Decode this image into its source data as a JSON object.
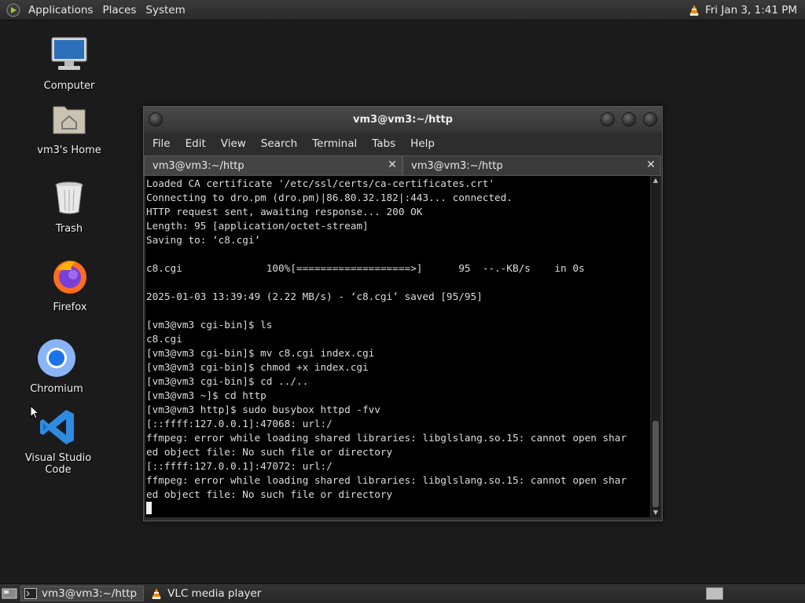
{
  "top_panel": {
    "menus": [
      "Applications",
      "Places",
      "System"
    ],
    "clock": "Fri Jan  3,  1:41 PM"
  },
  "desktop_icons": [
    {
      "label": "Computer",
      "icon": "computer-icon"
    },
    {
      "label": "vm3's Home",
      "icon": "home-folder-icon"
    },
    {
      "label": "Trash",
      "icon": "trash-icon"
    },
    {
      "label": "Firefox",
      "icon": "firefox-icon"
    },
    {
      "label": "Chromium",
      "icon": "chromium-icon"
    },
    {
      "label": "Visual Studio Code",
      "icon": "vscode-icon"
    }
  ],
  "terminal": {
    "title": "vm3@vm3:~/http",
    "menu": [
      "File",
      "Edit",
      "View",
      "Search",
      "Terminal",
      "Tabs",
      "Help"
    ],
    "tabs": [
      {
        "label": "vm3@vm3:~/http",
        "active": true
      },
      {
        "label": "vm3@vm3:~/http",
        "active": false
      }
    ],
    "lines": [
      "Loaded CA certificate '/etc/ssl/certs/ca-certificates.crt'",
      "Connecting to dro.pm (dro.pm)|86.80.32.182|:443... connected.",
      "HTTP request sent, awaiting response... 200 OK",
      "Length: 95 [application/octet-stream]",
      "Saving to: ‘c8.cgi’",
      "",
      "c8.cgi              100%[===================>]      95  --.-KB/s    in 0s",
      "",
      "2025-01-03 13:39:49 (2.22 MB/s) - ‘c8.cgi’ saved [95/95]",
      "",
      "[vm3@vm3 cgi-bin]$ ls",
      "c8.cgi",
      "[vm3@vm3 cgi-bin]$ mv c8.cgi index.cgi",
      "[vm3@vm3 cgi-bin]$ chmod +x index.cgi",
      "[vm3@vm3 cgi-bin]$ cd ../..",
      "[vm3@vm3 ~]$ cd http",
      "[vm3@vm3 http]$ sudo busybox httpd -fvv",
      "[::ffff:127.0.0.1]:47068: url:/",
      "ffmpeg: error while loading shared libraries: libglslang.so.15: cannot open shar",
      "ed object file: No such file or directory",
      "[::ffff:127.0.0.1]:47072: url:/",
      "ffmpeg: error while loading shared libraries: libglslang.so.15: cannot open shar",
      "ed object file: No such file or directory"
    ]
  },
  "taskbar": {
    "items": [
      {
        "label": "vm3@vm3:~/http",
        "icon": "terminal-icon",
        "active": true
      },
      {
        "label": "VLC media player",
        "icon": "vlc-icon",
        "active": false
      }
    ]
  },
  "colors": {
    "desktop_bg": "#1b1b1b",
    "panel_bg": "#2e2e2e",
    "terminal_bg": "#000000",
    "terminal_fg": "#dcdcdc"
  }
}
